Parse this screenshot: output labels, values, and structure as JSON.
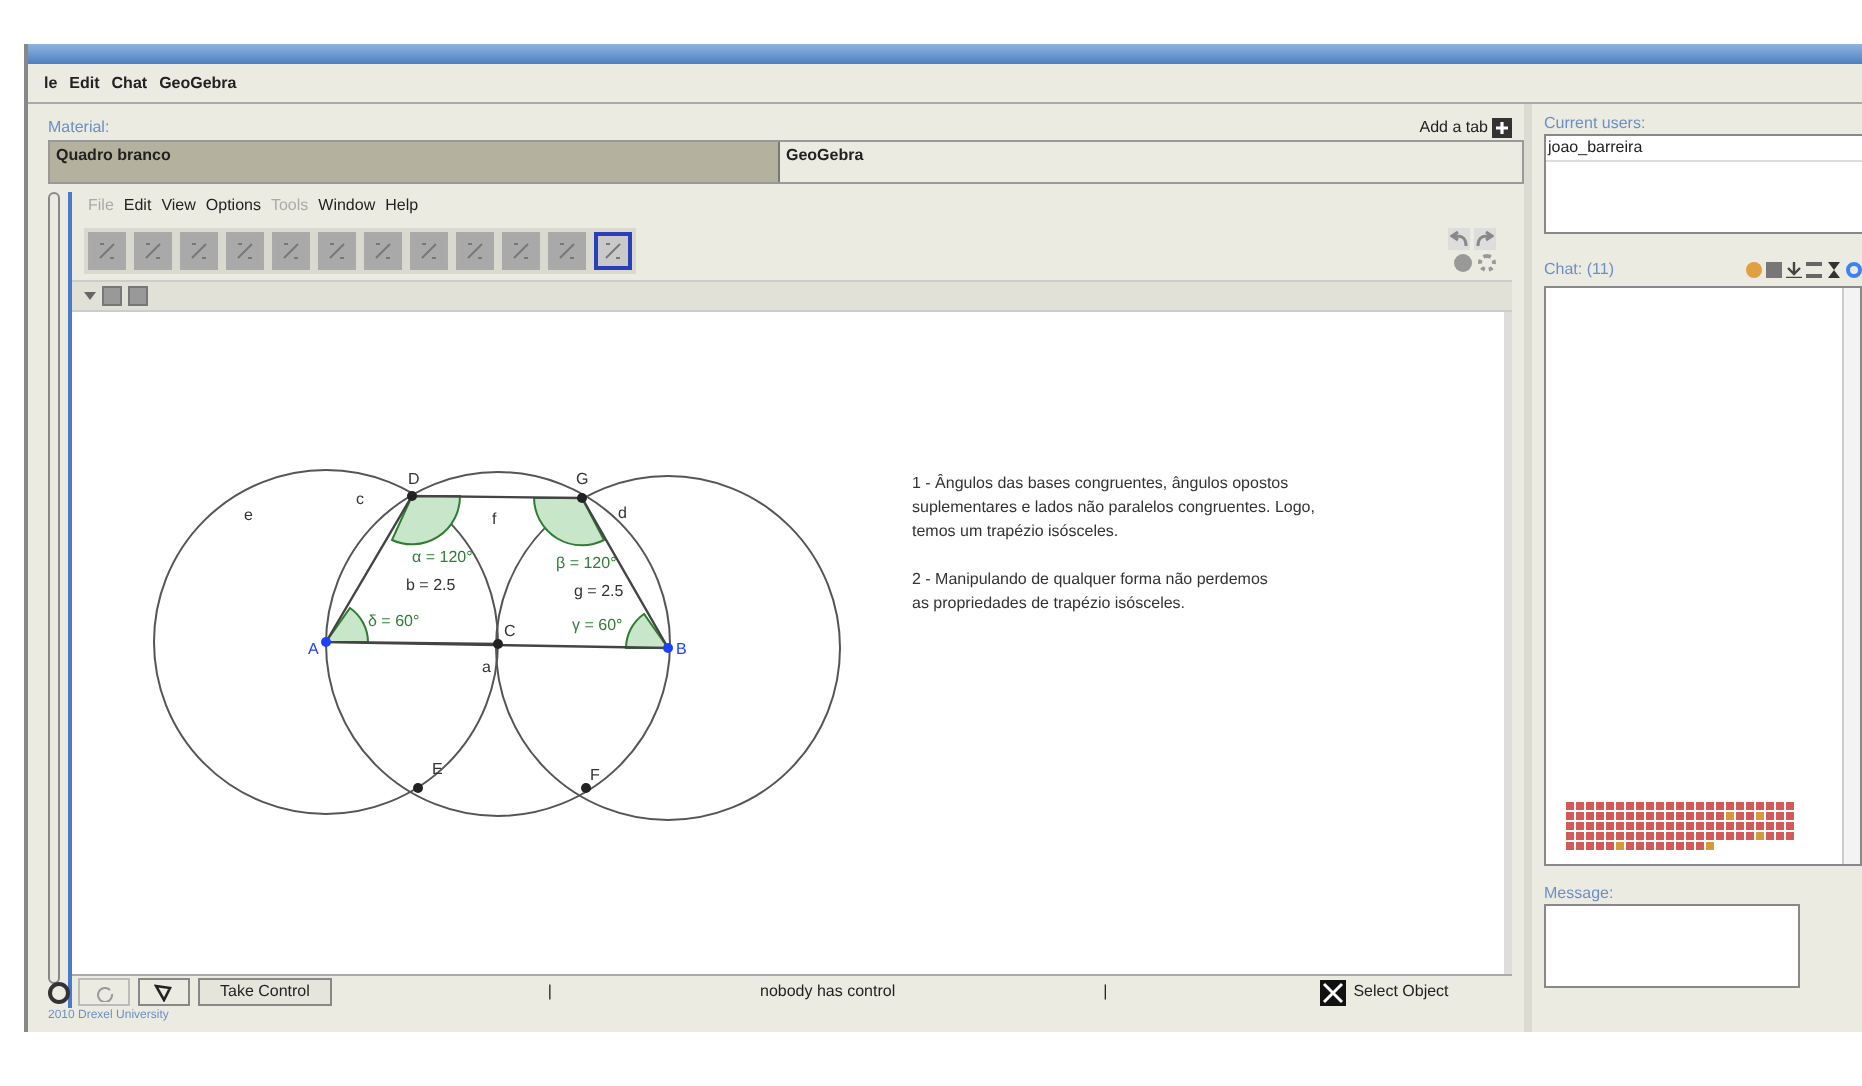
{
  "menu": [
    "le",
    "Edit",
    "Chat",
    "GeoGebra"
  ],
  "material": {
    "label": "Material:",
    "add_tab": "Add a tab",
    "tabs": [
      {
        "label": "Quadro branco",
        "selected": false
      },
      {
        "label": "GeoGebra",
        "selected": true
      }
    ]
  },
  "geogebra": {
    "menu": [
      {
        "label": "File",
        "disabled": true
      },
      {
        "label": "Edit",
        "disabled": false
      },
      {
        "label": "View",
        "disabled": false
      },
      {
        "label": "Options",
        "disabled": false
      },
      {
        "label": "Tools",
        "disabled": true
      },
      {
        "label": "Window",
        "disabled": false
      },
      {
        "label": "Help",
        "disabled": false
      }
    ],
    "tools": [
      {
        "selected": false
      },
      {
        "selected": false
      },
      {
        "selected": false
      },
      {
        "selected": false
      },
      {
        "selected": false
      },
      {
        "selected": false
      },
      {
        "selected": false
      },
      {
        "selected": false
      },
      {
        "selected": false
      },
      {
        "selected": false
      },
      {
        "selected": false
      },
      {
        "selected": true
      }
    ],
    "labels": [
      {
        "text": "D",
        "kind": "point"
      },
      {
        "text": "G",
        "kind": "point"
      },
      {
        "text": "c",
        "kind": "object"
      },
      {
        "text": "e",
        "kind": "object"
      },
      {
        "text": "f",
        "kind": "object"
      },
      {
        "text": "d",
        "kind": "object"
      },
      {
        "text": "α = 120°",
        "kind": "angle"
      },
      {
        "text": "β = 120°",
        "kind": "angle"
      },
      {
        "text": "b = 2.5",
        "kind": "object"
      },
      {
        "text": "g = 2.5",
        "kind": "object"
      },
      {
        "text": "δ = 60°",
        "kind": "angle"
      },
      {
        "text": "γ = 60°",
        "kind": "angle"
      },
      {
        "text": "A",
        "kind": "free-point"
      },
      {
        "text": "C",
        "kind": "point"
      },
      {
        "text": "B",
        "kind": "free-point"
      },
      {
        "text": "a",
        "kind": "object"
      },
      {
        "text": "E",
        "kind": "point"
      },
      {
        "text": "F",
        "kind": "point"
      }
    ],
    "notes": [
      [
        "1 - Ângulos das bases congruentes, ângulos opostos",
        "suplementares e lados não paralelos congruentes. Logo,",
        "temos um trapézio isósceles."
      ],
      [
        "2 - Manipulando de qualquer forma não perdemos",
        "as propriedades de trapézio isósceles."
      ]
    ]
  },
  "control_bar": {
    "take_control": "Take Control",
    "separator_left": "|",
    "status": "nobody has control",
    "separator_right": "|",
    "select_object": "Select Object"
  },
  "footer": "2010 Drexel University",
  "users": {
    "label": "Current users:",
    "items": [
      "joao_barreira"
    ]
  },
  "chat": {
    "label": "Chat: (11)"
  },
  "message": {
    "label": "Message:"
  }
}
